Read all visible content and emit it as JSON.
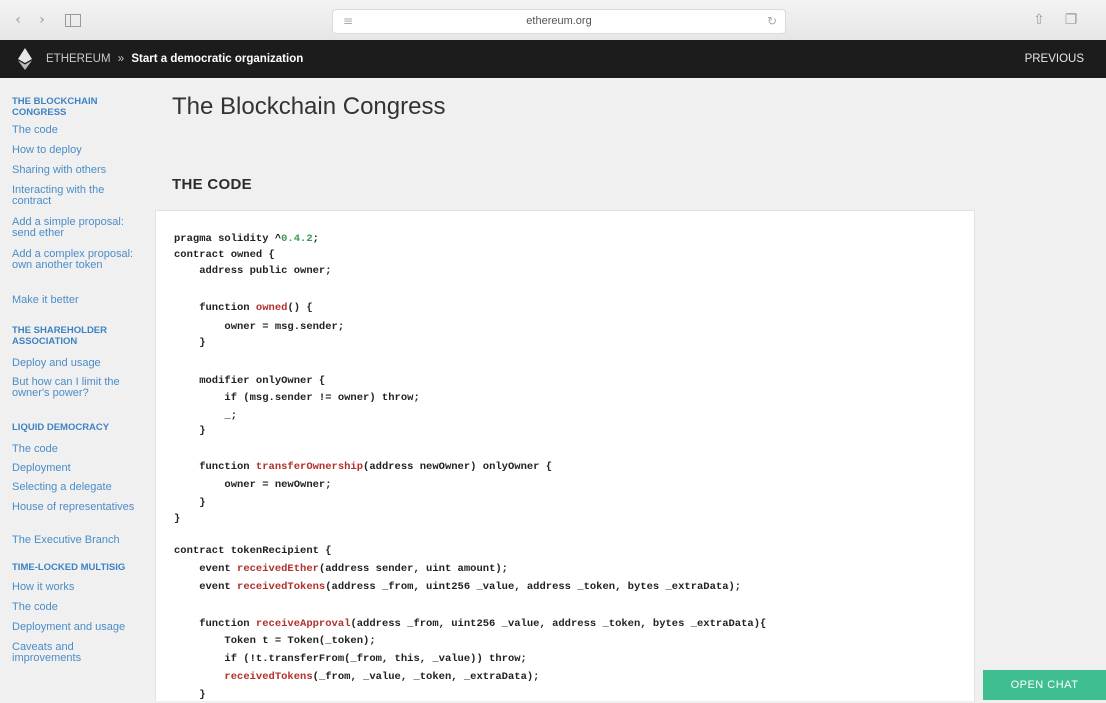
{
  "browser": {
    "url": "ethereum.org",
    "icons": [
      "back-icon",
      "forward-icon",
      "sidebar-icon",
      "reader-icon",
      "lock-icon",
      "reload-icon",
      "share-icon",
      "tabs-icon"
    ]
  },
  "header": {
    "site_name": "ETHEREUM",
    "separator": "»",
    "page_name": "Start a democratic organization",
    "previous_label": "PREVIOUS"
  },
  "sidebar": {
    "items": [
      {
        "label": "THE BLOCKCHAIN CONGRESS",
        "type": "heading"
      },
      {
        "label": "The code",
        "type": "link"
      },
      {
        "label": "How to deploy",
        "type": "link"
      },
      {
        "label": "Sharing with others",
        "type": "link"
      },
      {
        "label": "Interacting with the contract",
        "type": "link"
      },
      {
        "label": "Add a simple proposal: send ether",
        "type": "link"
      },
      {
        "label": "Add a complex proposal: own another token",
        "type": "link"
      },
      {
        "label": "Make it better",
        "type": "link"
      },
      {
        "label": "THE SHAREHOLDER ASSOCIATION",
        "type": "heading"
      },
      {
        "label": "Deploy and usage",
        "type": "link"
      },
      {
        "label": "But how can I limit the owner's power?",
        "type": "link"
      },
      {
        "label": "LIQUID DEMOCRACY",
        "type": "heading"
      },
      {
        "label": "The code",
        "type": "link"
      },
      {
        "label": "Deployment",
        "type": "link"
      },
      {
        "label": "Selecting a delegate",
        "type": "link"
      },
      {
        "label": "House of representatives",
        "type": "link"
      },
      {
        "label": "The Executive Branch",
        "type": "link"
      },
      {
        "label": "TIME-LOCKED MULTISIG",
        "type": "heading"
      },
      {
        "label": "How it works",
        "type": "link"
      },
      {
        "label": "The code",
        "type": "link"
      },
      {
        "label": "Deployment and usage",
        "type": "link"
      },
      {
        "label": "Caveats and improvements",
        "type": "link"
      }
    ]
  },
  "main": {
    "title": "The Blockchain Congress",
    "section_title": "THE CODE",
    "code_lines": [
      "pragma solidity ^0.4.2;",
      "contract owned {",
      "    address public owner;",
      "",
      "    function owned() {",
      "        owner = msg.sender;",
      "    }",
      "",
      "    modifier onlyOwner {",
      "        if (msg.sender != owner) throw;",
      "        _;",
      "    }",
      "",
      "    function transferOwnership(address newOwner) onlyOwner {",
      "        owner = newOwner;",
      "    }",
      "}",
      "",
      "contract tokenRecipient {",
      "    event receivedEther(address sender, uint amount);",
      "    event receivedTokens(address _from, uint256 _value, address _token, bytes _extraData);",
      "",
      "    function receiveApproval(address _from, uint256 _value, address _token, bytes _extraData){",
      "        Token t = Token(_token);",
      "        if (!t.transferFrom(_from, this, _value)) throw;",
      "        receivedTokens(_from, _value, _token, _extraData);",
      "    }"
    ],
    "highlight_names": [
      "owned",
      "transferOwnership",
      "receivedEther",
      "receivedTokens",
      "receiveApproval"
    ],
    "highlight_numbers": [
      "0.4.2"
    ]
  },
  "chat": {
    "label": "OPEN CHAT"
  }
}
